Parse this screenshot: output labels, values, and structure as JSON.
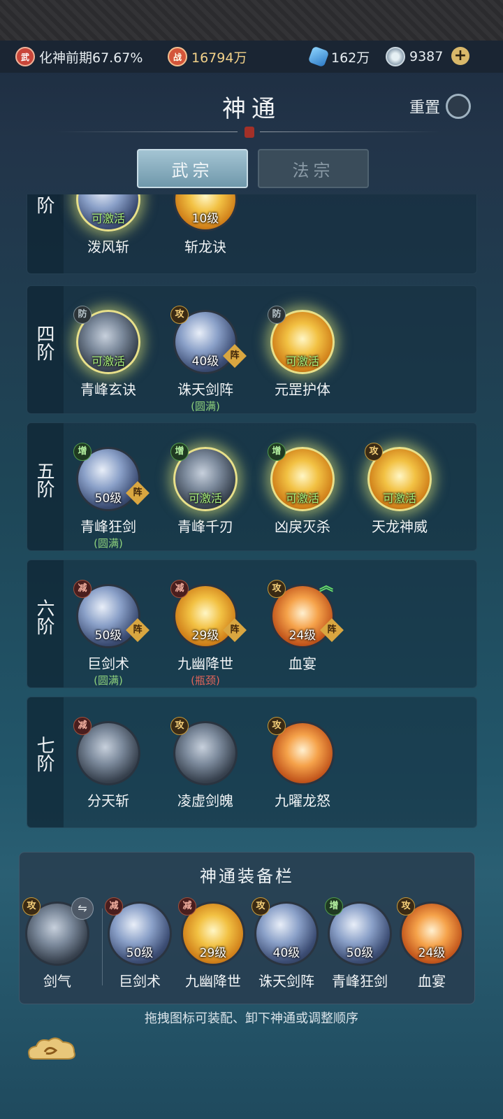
{
  "status": {
    "realm_icon": "武",
    "realm_text": "化神前期67.67%",
    "power_icon": "战",
    "power_value": "16794万",
    "crystal_value": "162万",
    "coin_value": "9387",
    "plus_label": "+"
  },
  "header": {
    "title": "神通",
    "reset_label": "重置"
  },
  "tabs": [
    {
      "label": "武宗",
      "active": true
    },
    {
      "label": "法宗",
      "active": false
    }
  ],
  "tiers": [
    {
      "label": "三阶",
      "skills": [
        {
          "name": "泼风斩",
          "status": "可激活"
        },
        {
          "name": "斩龙诀",
          "level": "10级"
        }
      ]
    },
    {
      "label": "四阶",
      "skills": [
        {
          "name": "青峰玄诀",
          "badge": "防",
          "status": "可激活"
        },
        {
          "name": "诛天剑阵",
          "badge": "攻",
          "level": "40级",
          "formation": "阵",
          "note": "(圆满)"
        },
        {
          "name": "元罡护体",
          "badge": "防",
          "status": "可激活"
        }
      ]
    },
    {
      "label": "五阶",
      "skills": [
        {
          "name": "青峰狂剑",
          "badge": "增",
          "level": "50级",
          "formation": "阵",
          "note": "(圆满)"
        },
        {
          "name": "青峰千刃",
          "badge": "增",
          "status": "可激活"
        },
        {
          "name": "凶戾灭杀",
          "badge": "增",
          "status": "可激活"
        },
        {
          "name": "天龙神威",
          "badge": "攻",
          "status": "可激活"
        }
      ]
    },
    {
      "label": "六阶",
      "skills": [
        {
          "name": "巨剑术",
          "badge": "减",
          "level": "50级",
          "formation": "阵",
          "note": "(圆满)"
        },
        {
          "name": "九幽降世",
          "badge": "减",
          "level": "29级",
          "formation": "阵",
          "note": "(瓶颈)"
        },
        {
          "name": "血宴",
          "badge": "攻",
          "level": "24级",
          "formation": "阵"
        }
      ]
    },
    {
      "label": "七阶",
      "skills": [
        {
          "name": "分天斩",
          "badge": "减"
        },
        {
          "name": "凌虚剑魄",
          "badge": "攻"
        },
        {
          "name": "九曜龙怒",
          "badge": "攻"
        }
      ]
    }
  ],
  "equip_bar": {
    "title": "神通装备栏",
    "swap_icon": "⇋",
    "slots": [
      {
        "name": "剑气",
        "badge": "攻"
      },
      {
        "name": "巨剑术",
        "badge": "减",
        "level": "50级"
      },
      {
        "name": "九幽降世",
        "badge": "减",
        "level": "29级"
      },
      {
        "name": "诛天剑阵",
        "badge": "攻",
        "level": "40级"
      },
      {
        "name": "青峰狂剑",
        "badge": "增",
        "level": "50级"
      },
      {
        "name": "血宴",
        "badge": "攻",
        "level": "24级"
      }
    ]
  },
  "hint": "拖拽图标可装配、卸下神通或调整顺序",
  "colors": {
    "activate": "#a8f07a",
    "complete": "#8ed17c",
    "bottleneck": "#e2655a",
    "formation": "#d9a640"
  }
}
